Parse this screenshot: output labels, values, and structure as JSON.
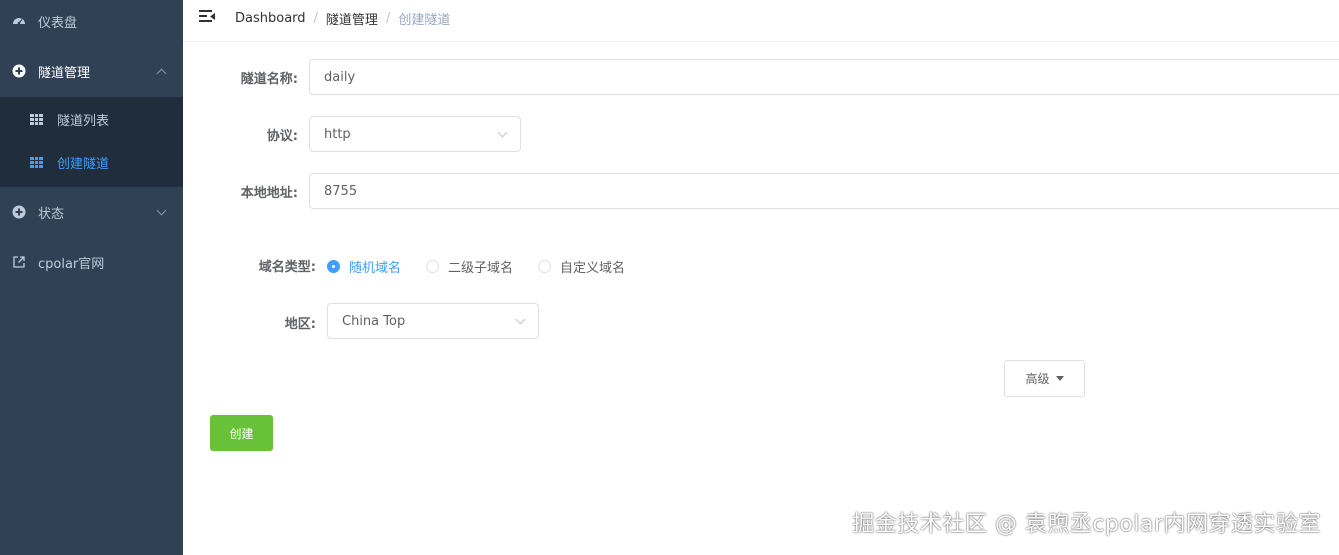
{
  "sidebar": {
    "dashboard": "仪表盘",
    "tunnel_management": "隧道管理",
    "tunnel_list": "隧道列表",
    "create_tunnel": "创建隧道",
    "status": "状态",
    "official_site": "cpolar官网"
  },
  "breadcrumb": [
    "Dashboard",
    "隧道管理",
    "创建隧道"
  ],
  "form": {
    "tunnel_name_label": "隧道名称:",
    "tunnel_name_value": "daily",
    "protocol_label": "协议:",
    "protocol_value": "http",
    "local_address_label": "本地地址:",
    "local_address_value": "8755",
    "domain_type_label": "域名类型:",
    "domain_type_options": [
      "随机域名",
      "二级子域名",
      "自定义域名"
    ],
    "domain_type_selected": "随机域名",
    "region_label": "地区:",
    "region_value": "China Top",
    "advanced_label": "高级",
    "create_label": "创建"
  },
  "watermark": "掘金技术社区 @ 袁煦丞cpolar内网穿透实验室",
  "colors": {
    "sidebar_bg": "#304156",
    "submenu_bg": "#1f2d3d",
    "active": "#409eff",
    "create_button": "#67c23a"
  }
}
